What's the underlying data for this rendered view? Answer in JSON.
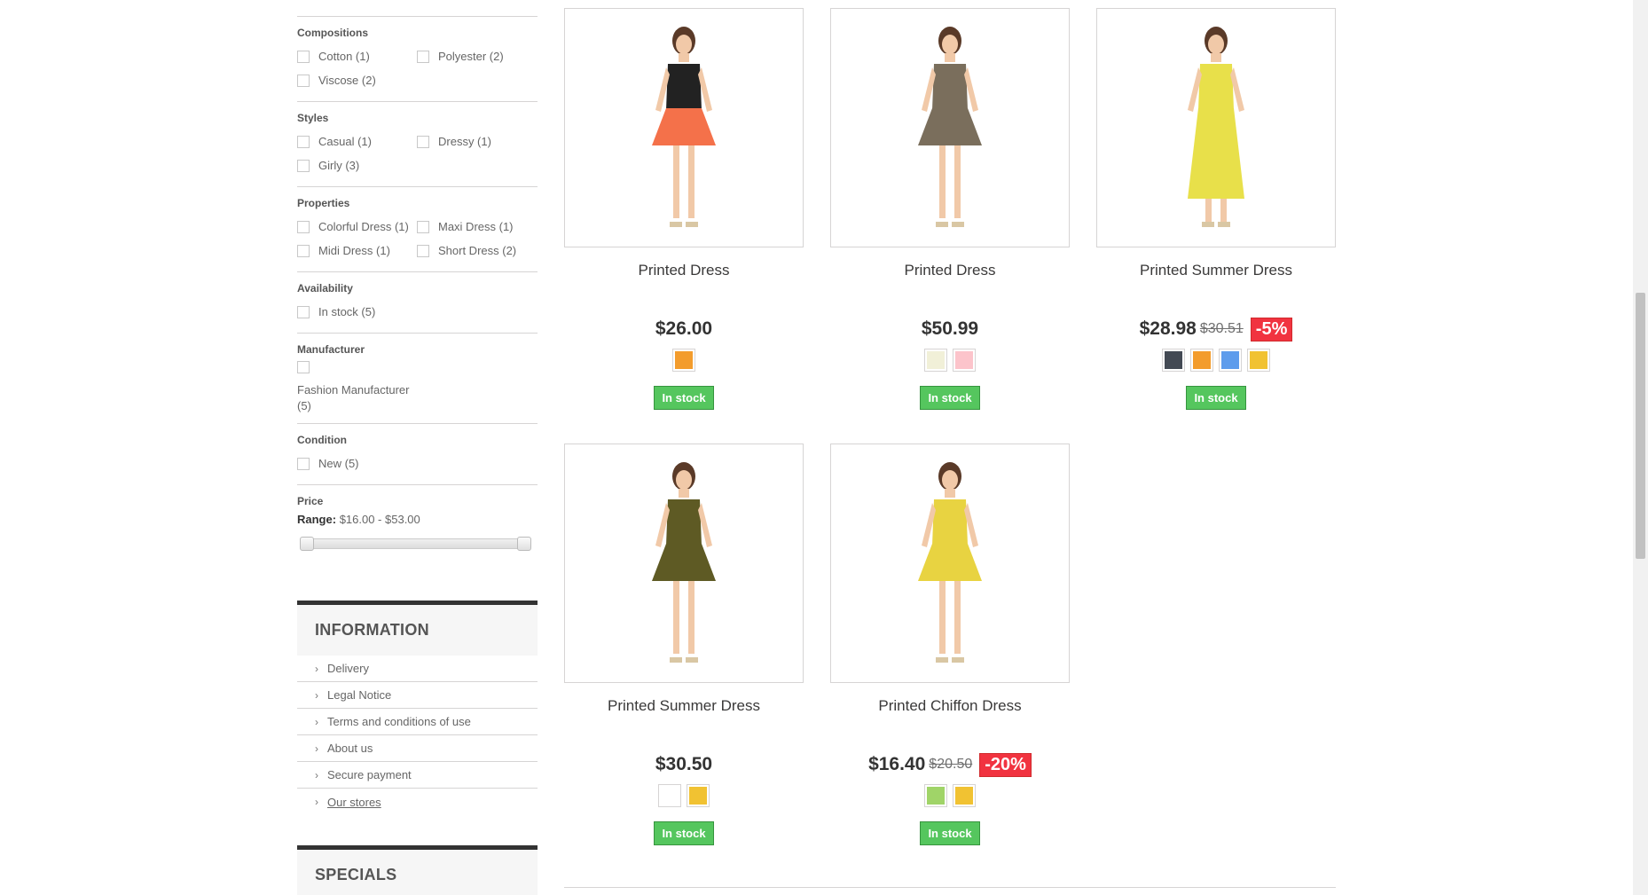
{
  "filters": [
    {
      "title": "Compositions",
      "options": [
        "Cotton (1)",
        "Polyester (2)",
        "Viscose (2)"
      ]
    },
    {
      "title": "Styles",
      "options": [
        "Casual (1)",
        "Dressy (1)",
        "Girly (3)"
      ]
    },
    {
      "title": "Properties",
      "options": [
        "Colorful Dress (1)",
        "Maxi Dress (1)",
        "Midi Dress (1)",
        "Short Dress (2)"
      ]
    },
    {
      "title": "Availability",
      "options": [
        "In stock (5)"
      ]
    }
  ],
  "manufacturer": {
    "title": "Manufacturer",
    "option": "Fashion Manufacturer (5)"
  },
  "condition": {
    "title": "Condition",
    "option": "New (5)"
  },
  "price": {
    "title": "Price",
    "range_label": "Range:",
    "range_value": "$16.00 - $53.00"
  },
  "information": {
    "title": "INFORMATION",
    "links": [
      "Delivery",
      "Legal Notice",
      "Terms and conditions of use",
      "About us",
      "Secure payment",
      "Our stores"
    ]
  },
  "specials": {
    "title": "SPECIALS"
  },
  "products": [
    {
      "name": "Printed Dress",
      "price": "$26.00",
      "old_price": "",
      "discount": "",
      "stock": "In stock",
      "swatches": [
        "#f39c2c"
      ],
      "dress": "#f4714a",
      "top": "#222"
    },
    {
      "name": "Printed Dress",
      "price": "$50.99",
      "old_price": "",
      "discount": "",
      "stock": "In stock",
      "swatches": [
        "#f1f0d8",
        "#fcc4cb"
      ],
      "dress": "#7a6e5c",
      "top": "#7a6e5c"
    },
    {
      "name": "Printed Summer Dress",
      "price": "$28.98",
      "old_price": "$30.51",
      "discount": "-5%",
      "stock": "In stock",
      "swatches": [
        "#434a54",
        "#f39c2c",
        "#5d9cec",
        "#f1c232"
      ],
      "dress": "#e8e04a",
      "top": "#e8e04a"
    },
    {
      "name": "Printed Summer Dress",
      "price": "$30.50",
      "old_price": "",
      "discount": "",
      "stock": "In stock",
      "swatches": [
        "#ffffff",
        "#f1c232"
      ],
      "dress": "#5e5a24",
      "top": "#5e5a24"
    },
    {
      "name": "Printed Chiffon Dress",
      "price": "$16.40",
      "old_price": "$20.50",
      "discount": "-20%",
      "stock": "In stock",
      "swatches": [
        "#a0d468",
        "#f1c232"
      ],
      "dress": "#e8d341",
      "top": "#e8d341"
    }
  ]
}
